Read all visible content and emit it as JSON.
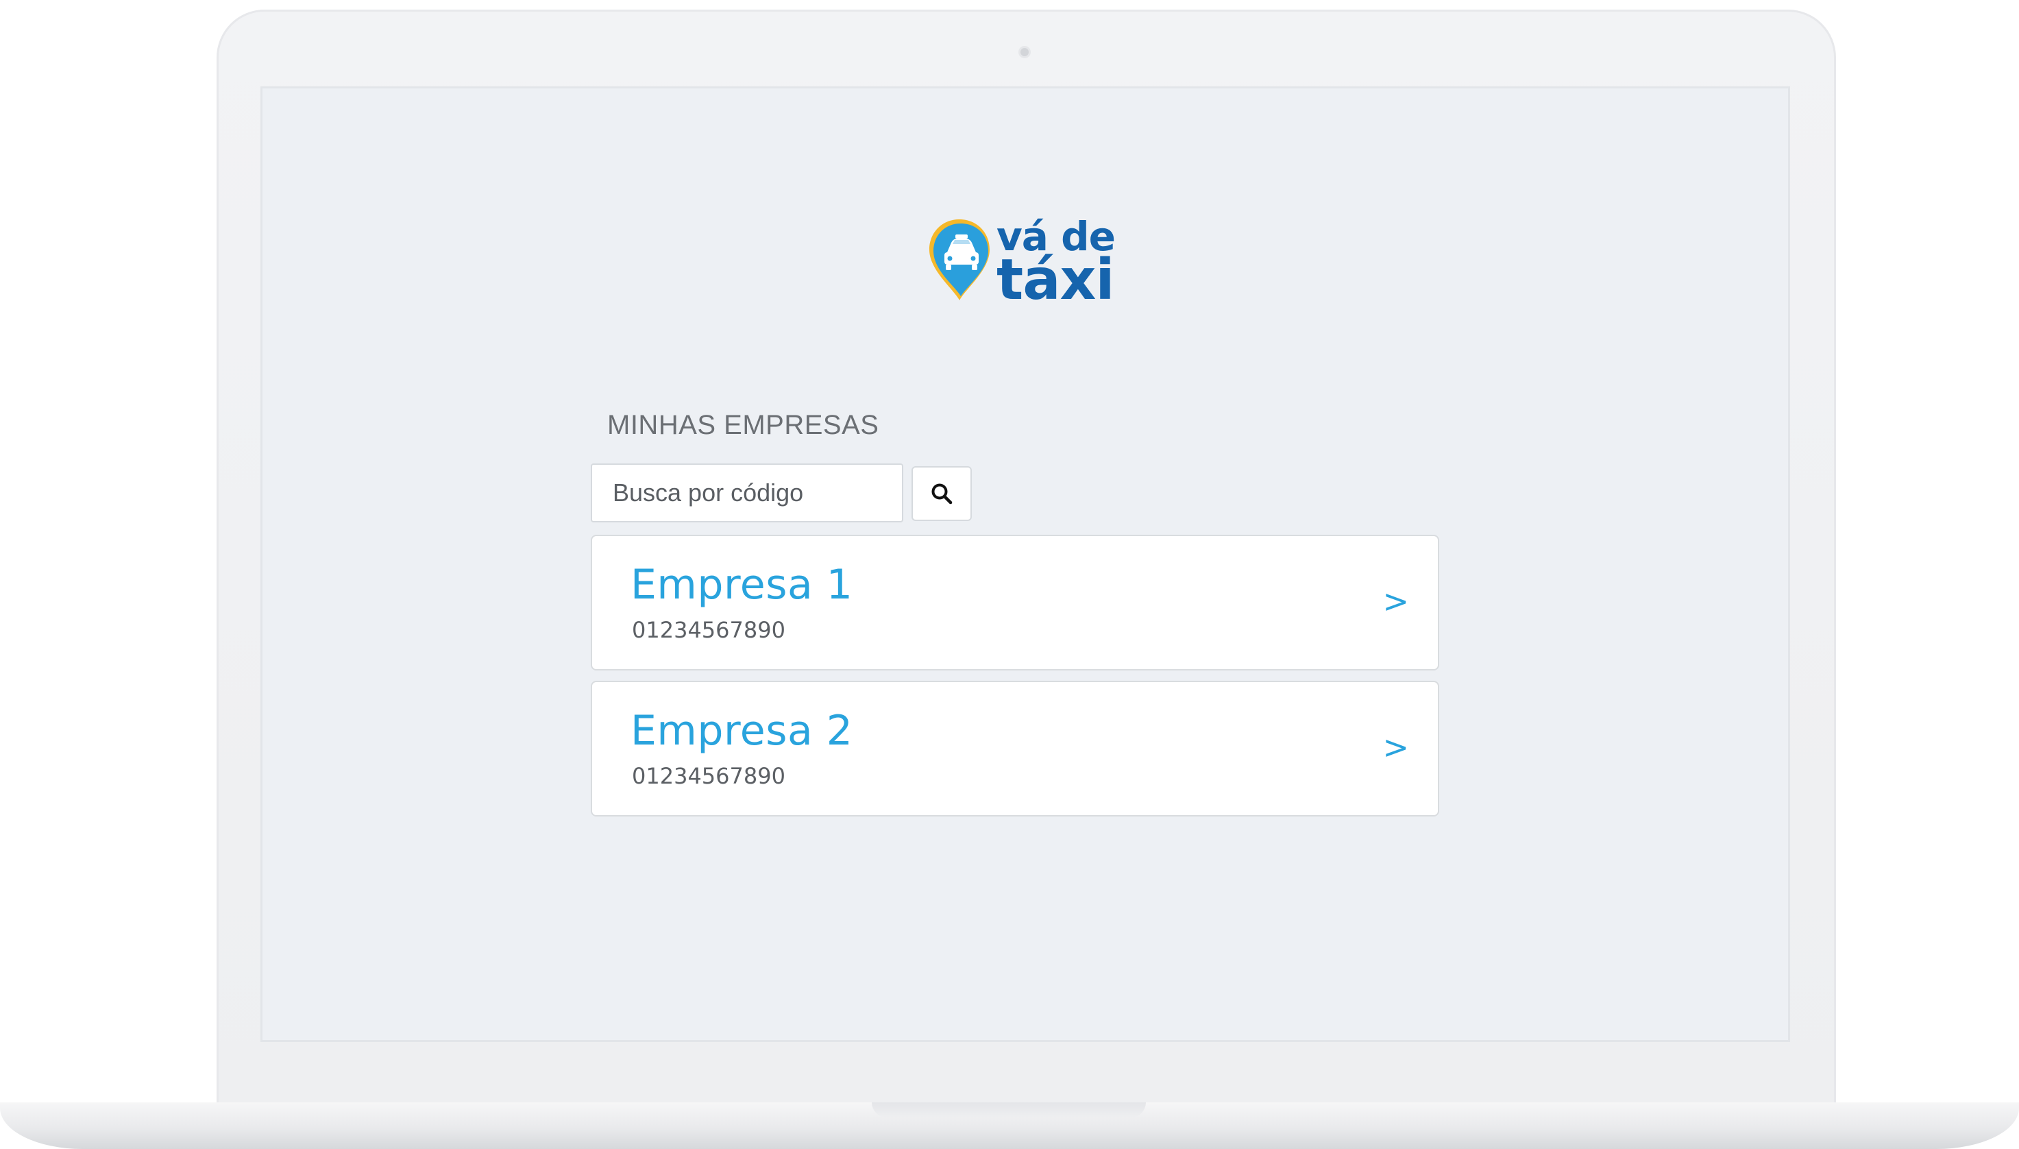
{
  "brand": {
    "line1": "vá de",
    "line2": "táxi",
    "colors": {
      "text": "#1664ad",
      "pin": "#2a9fdc",
      "pin_ring": "#f5b82a"
    }
  },
  "companies_section": {
    "title": "MINHAS EMPRESAS",
    "search": {
      "placeholder": "Busca por código",
      "value": ""
    },
    "search_icon": "search-icon",
    "items": [
      {
        "name": "Empresa 1",
        "code": "01234567890",
        "arrow": ">"
      },
      {
        "name": "Empresa 2",
        "code": "01234567890",
        "arrow": ">"
      }
    ]
  },
  "colors": {
    "accent": "#29a3dd",
    "screen_background": "#edf0f4",
    "card_background": "#ffffff"
  }
}
